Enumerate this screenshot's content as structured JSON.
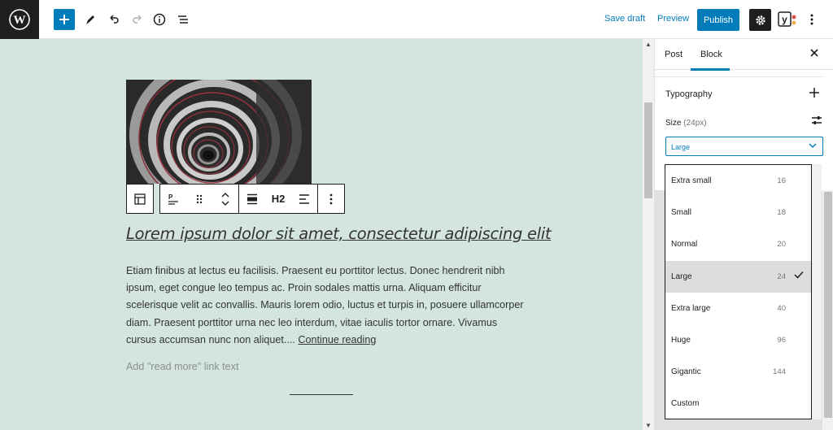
{
  "topbar": {
    "save_draft": "Save draft",
    "preview": "Preview",
    "publish": "Publish",
    "icons": [
      "wordpress-logo",
      "plus-icon",
      "pen-icon",
      "undo-icon",
      "redo-icon",
      "info-icon",
      "list-view-icon",
      "gear-icon",
      "yoast-icon",
      "more-vertical-icon"
    ]
  },
  "block_toolbar": {
    "heading_level": "H2"
  },
  "post": {
    "heading": "Lorem ipsum dolor sit amet, consectetur adipiscing elit",
    "excerpt": "Etiam finibus at lectus eu facilisis. Praesent eu porttitor lectus. Donec hendrerit nibh ipsum, eget congue leo tempus ac. Proin sodales mattis urna. Aliquam efficitur scelerisque velit ac convallis. Mauris lorem odio, luctus et turpis in, posuere ullamcorper diam. Praesent porttitor urna nec leo interdum, vitae iaculis tortor ornare. Vivamus cursus accumsan nunc non aliquet....",
    "continue": "Continue reading",
    "read_more_placeholder": "Add \"read more\" link text"
  },
  "sidebar": {
    "tabs": [
      "Post",
      "Block"
    ],
    "active_tab": "Block",
    "typography_title": "Typography",
    "size_label": "Size",
    "size_hint": "(24px)",
    "selected": "Large",
    "options": [
      {
        "label": "Extra small",
        "value": "16"
      },
      {
        "label": "Small",
        "value": "18"
      },
      {
        "label": "Normal",
        "value": "20"
      },
      {
        "label": "Large",
        "value": "24"
      },
      {
        "label": "Extra large",
        "value": "40"
      },
      {
        "label": "Huge",
        "value": "96"
      },
      {
        "label": "Gigantic",
        "value": "144"
      },
      {
        "label": "Custom",
        "value": ""
      }
    ]
  },
  "colors": {
    "accent": "#007cba",
    "canvas_bg": "#d3e5de",
    "dark": "#1e1e1e"
  }
}
